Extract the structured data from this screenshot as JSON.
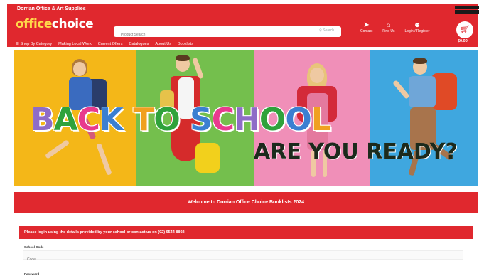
{
  "header": {
    "store_name": "Dorrian Office & Art Supplies",
    "logo_office": "office",
    "logo_choice": "choice",
    "logo_tagline": "",
    "search": {
      "placeholder": "Product Search",
      "button_label": "Search"
    },
    "icons": [
      {
        "name": "contact-icon",
        "label": "Contact",
        "glyph": "➤"
      },
      {
        "name": "find-us-icon",
        "label": "Find Us",
        "glyph": "⌂"
      },
      {
        "name": "user-icon",
        "label": "Login / Register",
        "glyph": "☻"
      }
    ],
    "cart_total": "$0.00",
    "badges": [
      "",
      ""
    ]
  },
  "nav": {
    "items": [
      "Shop By Category",
      "Making Local Work",
      "Current Offers",
      "Catalogues",
      "About Us",
      "Booklists"
    ]
  },
  "banner": {
    "headline_letters": [
      {
        "char": "B",
        "color": "#8e6cc7"
      },
      {
        "char": "A",
        "color": "#2fa23b"
      },
      {
        "char": "C",
        "color": "#e83a8e"
      },
      {
        "char": "K",
        "color": "#3b7fd1"
      },
      {
        "char": " ",
        "color": "#ffffff"
      },
      {
        "char": "T",
        "color": "#f0a020"
      },
      {
        "char": "O",
        "color": "#2fa23b"
      },
      {
        "char": " ",
        "color": "#ffffff"
      },
      {
        "char": "S",
        "color": "#3b7fd1"
      },
      {
        "char": "C",
        "color": "#e83a8e"
      },
      {
        "char": "H",
        "color": "#8e6cc7"
      },
      {
        "char": "O",
        "color": "#2fa23b"
      },
      {
        "char": "O",
        "color": "#3b7fd1"
      },
      {
        "char": "L",
        "color": "#f0a020"
      }
    ],
    "subheadline": "ARE YOU READY?"
  },
  "welcome": {
    "text": "Welcome to Dorrian Office Choice Booklists 2024"
  },
  "login": {
    "instructions": "Please login using the details provided by your school or contact us on (02) 6544 8802",
    "school_code_label": "School Code",
    "school_code_placeholder": "Code",
    "password_label": "Password"
  },
  "colors": {
    "brand_red": "#e0282e",
    "logo_yellow": "#ffd84a"
  }
}
